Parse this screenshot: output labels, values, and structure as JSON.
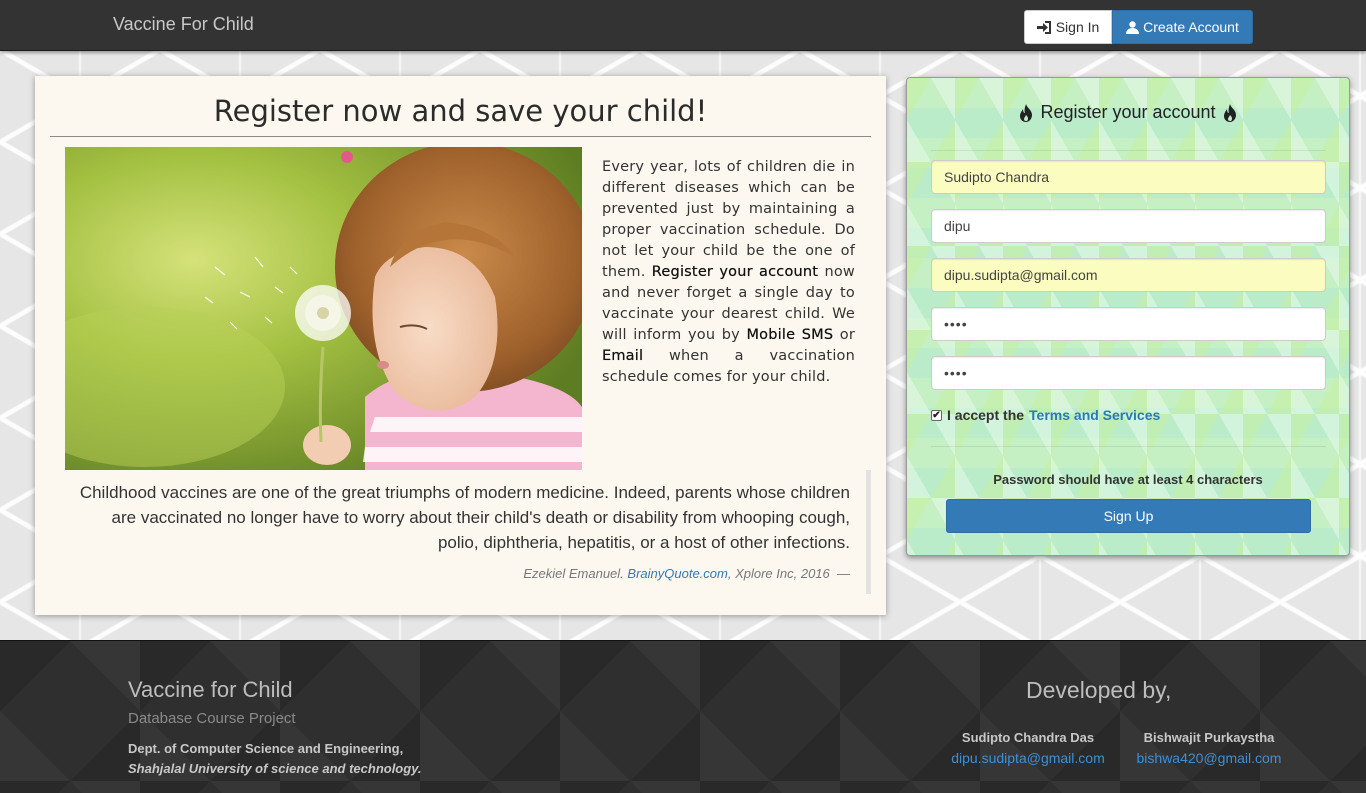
{
  "navbar": {
    "brand": "Vaccine For Child",
    "sign_in": "Sign In",
    "create_account": "Create Account"
  },
  "main": {
    "title": "Register now and save your child!",
    "intro_1": "Every year, lots of children die in different diseases which can be prevented just by maintaining a proper vaccination schedule. Do not let your child be the one of them.",
    "intro_register": "Register your account",
    "intro_2": "now and never forget a single day to vaccinate your dearest child. We will inform you by",
    "intro_sms": "Mobile SMS",
    "intro_or": "or",
    "intro_email": "Email",
    "intro_3": "when a vaccination schedule comes for your child.",
    "quote": "Childhood vaccines are one of the great triumphs of modern medicine. Indeed, parents whose children are vaccinated no longer have to worry about their child's death or disability from whooping cough, polio, diphtheria, hepatitis, or a host of other infections.",
    "quote_author": "Ezekiel Emanuel.",
    "quote_link": "BrainyQuote.com",
    "quote_rest": ", Xplore Inc, 2016",
    "quote_dash": "—"
  },
  "register": {
    "title": "Register your account",
    "fullname": "Sudipto Chandra",
    "username": "dipu",
    "email": "dipu.sudipta@gmail.com",
    "password": "••••",
    "confirm_password": "••••",
    "accept_prefix": "I accept the",
    "terms_link": "Terms and Services",
    "terms_checked": true,
    "password_hint": "Password should have at least 4 characters",
    "submit": "Sign Up"
  },
  "footer": {
    "title": "Vaccine for Child",
    "subtitle": "Database Course Project",
    "dept": "Dept. of Computer Science and Engineering,",
    "university": "Shahjalal University of science and technology.",
    "developed_by": "Developed by,",
    "developers": [
      {
        "name": "Sudipto Chandra Das",
        "email": "dipu.sudipta@gmail.com"
      },
      {
        "name": "Bishwajit Purkaystha",
        "email": "bishwa420@gmail.com"
      }
    ]
  },
  "colors": {
    "navbar": "#333333",
    "primary": "#337ab7",
    "autofill": "#fafcc0"
  }
}
